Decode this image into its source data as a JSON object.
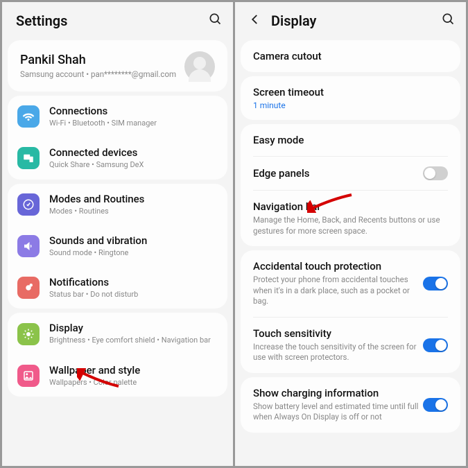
{
  "left": {
    "title": "Settings",
    "account": {
      "name": "Pankil Shah",
      "sub": "Samsung account  •  pan********@gmail.com"
    },
    "g1": [
      {
        "label": "Connections",
        "sub": "Wi-Fi  •  Bluetooth  •  SIM manager"
      },
      {
        "label": "Connected devices",
        "sub": "Quick Share  •  Samsung DeX"
      }
    ],
    "g2": [
      {
        "label": "Modes and Routines",
        "sub": "Modes  •  Routines"
      },
      {
        "label": "Sounds and vibration",
        "sub": "Sound mode  •  Ringtone"
      },
      {
        "label": "Notifications",
        "sub": "Status bar  •  Do not disturb"
      }
    ],
    "g3": [
      {
        "label": "Display",
        "sub": "Brightness  •  Eye comfort shield  •  Navigation bar"
      },
      {
        "label": "Wallpaper and style",
        "sub": "Wallpapers  •  Color palette"
      }
    ]
  },
  "right": {
    "title": "Display",
    "rows": {
      "camera_cutout": "Camera cutout",
      "screen_timeout": "Screen timeout",
      "screen_timeout_val": "1 minute",
      "easy_mode": "Easy mode",
      "edge_panels": "Edge panels",
      "nav_bar": "Navigation bar",
      "nav_bar_sub": "Manage the Home, Back, and Recents buttons or use gestures for more screen space.",
      "accidental": "Accidental touch protection",
      "accidental_sub": "Protect your phone from accidental touches when it's in a dark place, such as a pocket or bag.",
      "touch_sens": "Touch sensitivity",
      "touch_sens_sub": "Increase the touch sensitivity of the screen for use with screen protectors.",
      "charging": "Show charging information",
      "charging_sub": "Show battery level and estimated time until full when Always On Display is off or not"
    }
  }
}
